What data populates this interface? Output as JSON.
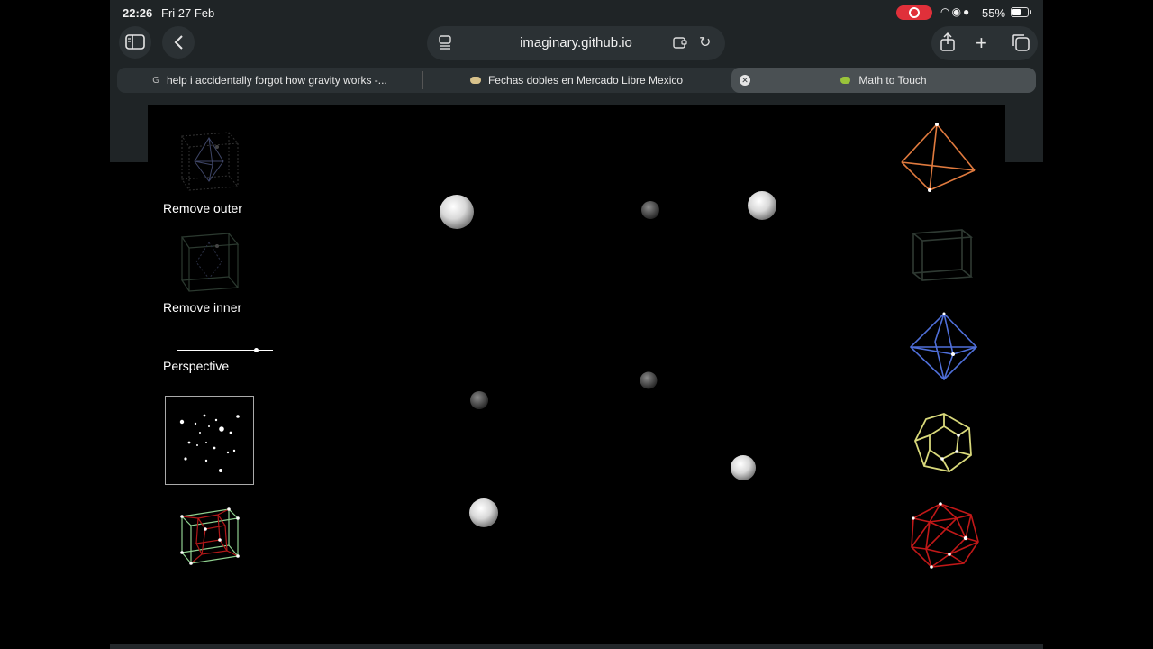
{
  "status_bar": {
    "time": "22:26",
    "date": "Fri 27 Feb",
    "battery": "55%",
    "icons": [
      "wifi-icon",
      "location-icon",
      "person-icon"
    ],
    "record_color": "#e0303a"
  },
  "toolbar": {
    "url": "imaginary.github.io",
    "icons": [
      "sidebar-icon",
      "back-icon",
      "page-icon",
      "extension-icon",
      "reload-icon",
      "share-icon",
      "plus-icon",
      "tabs-icon"
    ]
  },
  "tabs": [
    {
      "label": "help i accidentally forgot how gravity works -...",
      "favicon": "G"
    },
    {
      "label": "Fechas dobles en Mercado Libre Mexico"
    },
    {
      "label": "Math to Touch",
      "active": true
    }
  ],
  "controls": {
    "remove_outer": "Remove outer",
    "remove_inner": "Remove inner",
    "perspective": "Perspective",
    "perspective_value": 0.82
  },
  "solids": [
    "tetrahedron",
    "cube",
    "octahedron",
    "dodecahedron",
    "icosahedron"
  ],
  "colors": {
    "tetrahedron": "#e07a3e",
    "cube": "#2f3a33",
    "octahedron": "#4f6fd9",
    "dodecahedron": "#d8d87a",
    "icosahedron": "#c01818",
    "hypercube_outer": "#8fd08f",
    "hypercube_inner": "#b01818"
  }
}
